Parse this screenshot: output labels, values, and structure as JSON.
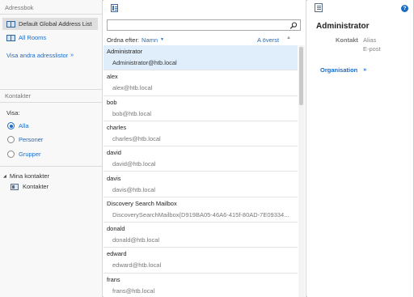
{
  "left": {
    "address_book_title": "Adressbok",
    "address_lists": [
      {
        "label": "Default Global Address List",
        "selected": true
      },
      {
        "label": "All Rooms",
        "selected": false
      }
    ],
    "more_lists_label": "Visa andra adresslistor",
    "contacts_title": "Kontakter",
    "show_label": "Visa:",
    "filters": [
      {
        "label": "Alla",
        "checked": true
      },
      {
        "label": "Personer",
        "checked": false
      },
      {
        "label": "Grupper",
        "checked": false
      }
    ],
    "tree_root_label": "Mina kontakter",
    "tree_child_label": "Kontakter"
  },
  "middle": {
    "search": {
      "value": "",
      "placeholder": ""
    },
    "sort_label": "Ordna efter:",
    "sort_value": "Namn",
    "sort_top_label": "A överst",
    "rows": [
      {
        "name": "Administrator",
        "email": "Administrator@htb.local",
        "selected": true
      },
      {
        "name": "alex",
        "email": "alex@htb.local",
        "selected": false
      },
      {
        "name": "bob",
        "email": "bob@htb.local",
        "selected": false
      },
      {
        "name": "charles",
        "email": "charles@htb.local",
        "selected": false
      },
      {
        "name": "david",
        "email": "david@htb.local",
        "selected": false
      },
      {
        "name": "davis",
        "email": "davis@htb.local",
        "selected": false
      },
      {
        "name": "Discovery Search Mailbox",
        "email": "DiscoverySearchMailbox{D919BA05-46A6-415f-80AD-7E09334...",
        "selected": false
      },
      {
        "name": "donald",
        "email": "donald@htb.local",
        "selected": false
      },
      {
        "name": "edward",
        "email": "edward@htb.local",
        "selected": false
      },
      {
        "name": "frans",
        "email": "frans@htb.local",
        "selected": false
      }
    ]
  },
  "right": {
    "title": "Administrator",
    "contact_label": "Kontakt",
    "contact_values": [
      "Alias",
      "E-post"
    ],
    "organisation_label": "Organisation",
    "help_glyph": "?"
  },
  "colors": {
    "accent": "#1c6cc5",
    "selected_row": "#dfeefa",
    "selected_list": "#dedede"
  }
}
